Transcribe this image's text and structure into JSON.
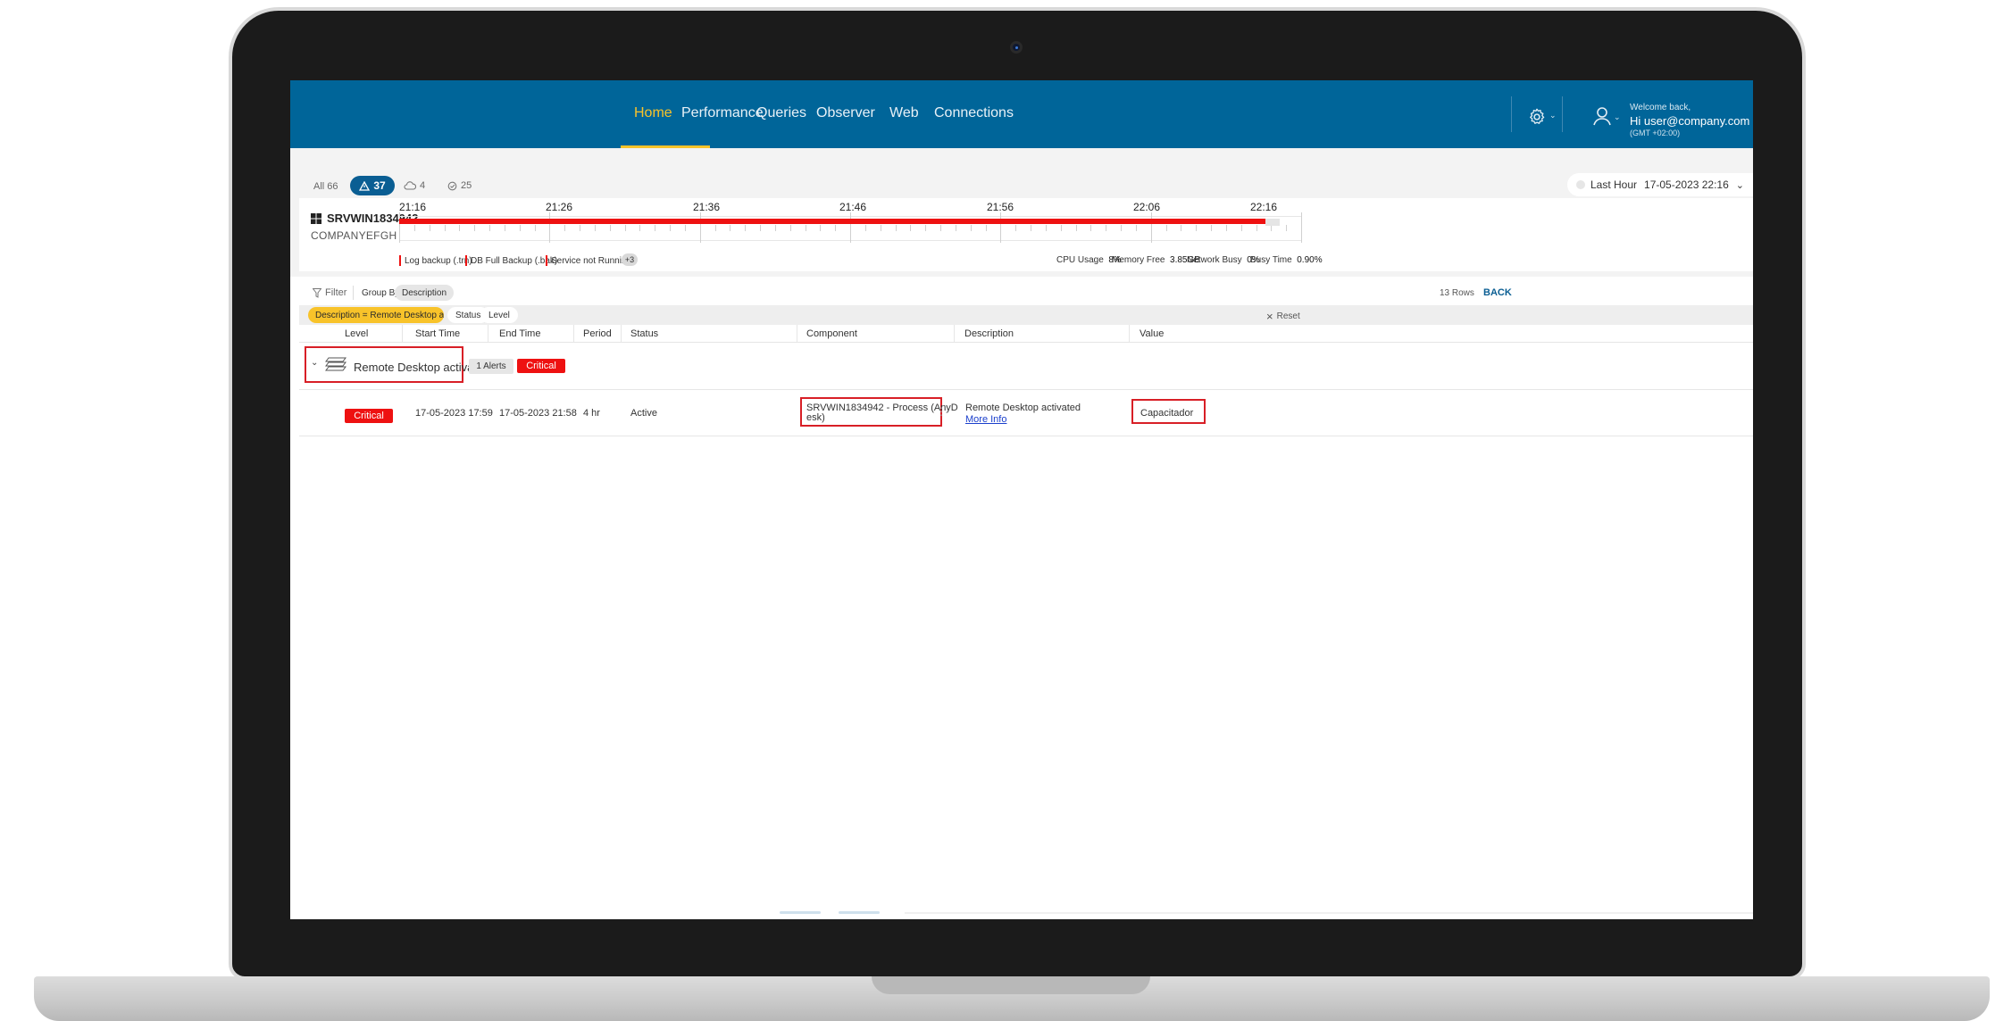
{
  "nav": {
    "tabs": [
      {
        "label": "Home"
      },
      {
        "label": "Performance"
      },
      {
        "label": "Queries"
      },
      {
        "label": "Observer"
      },
      {
        "label": "Web"
      },
      {
        "label": "Connections"
      }
    ],
    "active_tab": "Home",
    "welcome": "Welcome back,",
    "hi_user": "Hi  user@company.com",
    "gmt": "(GMT +02:00)",
    "accent_color": "#f8c32a",
    "bar_color": "#006599"
  },
  "counts": {
    "all": "All 66",
    "alerts": "37",
    "cloud": "4",
    "check": "25"
  },
  "time_range": {
    "label": "Last Hour",
    "value": "17-05-2023 22:16"
  },
  "server": {
    "name": "SRVWIN1834942",
    "company": "COMPANYEFGH",
    "ticks": [
      "21:16",
      "21:26",
      "21:36",
      "21:46",
      "21:56",
      "22:06",
      "22:16"
    ],
    "legend": [
      "Log backup (.trn)",
      "DB Full Backup (.bak)",
      "Service not Running"
    ],
    "legend_more": "+3",
    "stats": [
      {
        "label": "CPU Usage",
        "value": "8%"
      },
      {
        "label": "Memory Free",
        "value": "3.85GB"
      },
      {
        "label": "Network Busy",
        "value": "0%"
      },
      {
        "label": "Busy Time",
        "value": "0.90%"
      }
    ]
  },
  "toolbar": {
    "filter_label": "Filter",
    "group_by_label": "Group By",
    "group_by_value": "Description",
    "rows_count": "13 Rows",
    "back_label": "BACK"
  },
  "chips": {
    "active_filter": "Description = Remote Desktop acti...",
    "status": "Status",
    "level": "Level",
    "reset": "Reset"
  },
  "table": {
    "columns": [
      "Level",
      "Start Time",
      "End Time",
      "Period",
      "Status",
      "Component",
      "Description",
      "Value"
    ],
    "group": {
      "label": "Remote Desktop activated",
      "alerts": "1 Alerts",
      "level": "Critical"
    },
    "row": {
      "level": "Critical",
      "start_time": "17-05-2023 17:59",
      "end_time": "17-05-2023 21:58",
      "period": "4 hr",
      "status": "Active",
      "component_line1": "SRVWIN1834942 - Process (AnyD",
      "component_line2": "esk)",
      "description": "Remote Desktop activated",
      "more_info": "More Info",
      "value": "Capacitador"
    }
  }
}
